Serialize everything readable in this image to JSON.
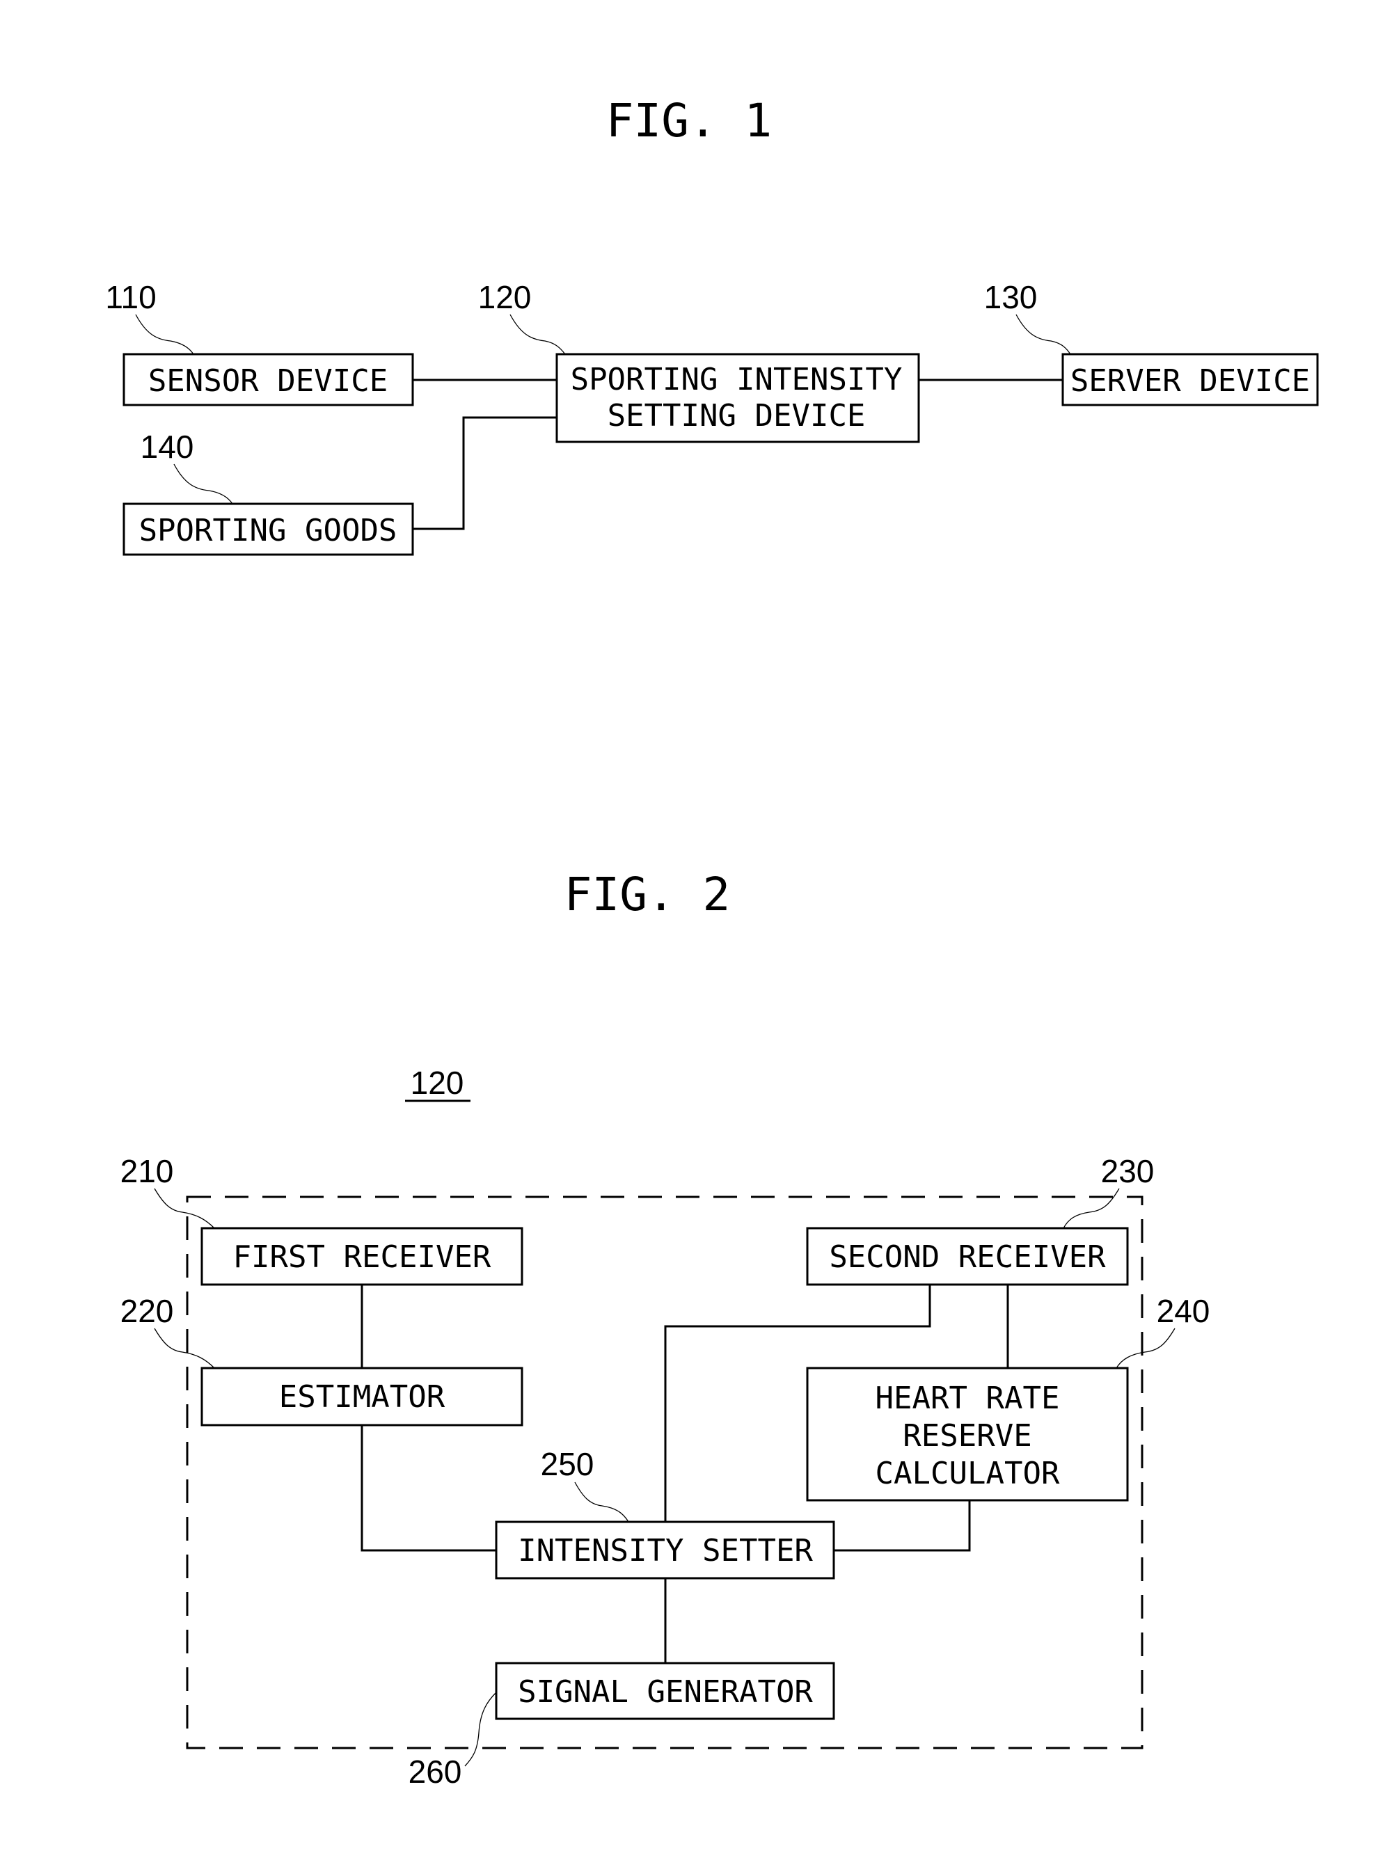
{
  "figures": {
    "fig1": {
      "title": "FIG. 1",
      "blocks": {
        "sensor": {
          "ref": "110",
          "label": [
            "SENSOR DEVICE"
          ]
        },
        "setting": {
          "ref": "120",
          "label": [
            "SPORTING INTENSITY",
            "SETTING DEVICE"
          ]
        },
        "server": {
          "ref": "130",
          "label": [
            "SERVER DEVICE"
          ]
        },
        "goods": {
          "ref": "140",
          "label": [
            "SPORTING GOODS"
          ]
        }
      }
    },
    "fig2": {
      "title": "FIG. 2",
      "container_ref": "120",
      "blocks": {
        "first_receiver": {
          "ref": "210",
          "label": [
            "FIRST RECEIVER"
          ]
        },
        "estimator": {
          "ref": "220",
          "label": [
            "ESTIMATOR"
          ]
        },
        "second_receiver": {
          "ref": "230",
          "label": [
            "SECOND RECEIVER"
          ]
        },
        "hrr_calculator": {
          "ref": "240",
          "label": [
            "HEART RATE",
            "RESERVE",
            "CALCULATOR"
          ]
        },
        "intensity_setter": {
          "ref": "250",
          "label": [
            "INTENSITY SETTER"
          ]
        },
        "signal_generator": {
          "ref": "260",
          "label": [
            "SIGNAL GENERATOR"
          ]
        }
      }
    }
  }
}
